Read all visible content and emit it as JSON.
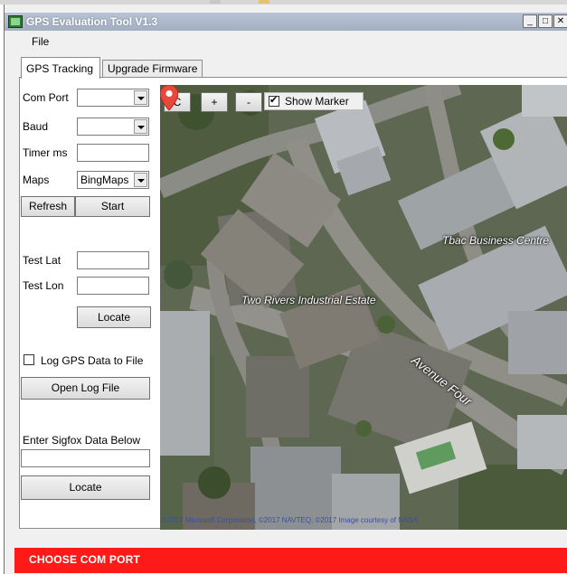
{
  "window": {
    "title": "GPS Evaluation Tool V1.3"
  },
  "menu": {
    "file_label": "File"
  },
  "tabs": [
    {
      "label": "GPS Tracking",
      "active": true
    },
    {
      "label": "Upgrade Firmware",
      "active": false
    }
  ],
  "form": {
    "com_port": {
      "label": "Com Port",
      "value": ""
    },
    "baud": {
      "label": "Baud",
      "value": ""
    },
    "timer": {
      "label": "Timer ms",
      "value": ""
    },
    "maps": {
      "label": "Maps",
      "value": "BingMaps"
    },
    "refresh_label": "Refresh",
    "start_label": "Start",
    "test_lat": {
      "label": "Test Lat",
      "value": ""
    },
    "test_lon": {
      "label": "Test Lon",
      "value": ""
    },
    "locate_label": "Locate",
    "log_gps": {
      "label": "Log GPS Data to File",
      "checked": false
    },
    "open_log_label": "Open Log File",
    "sigfox": {
      "label": "Enter Sigfox Data Below",
      "value": ""
    },
    "sigfox_locate_label": "Locate"
  },
  "map": {
    "controls": {
      "center": "C",
      "zoom_in": "+",
      "zoom_out": "-"
    },
    "show_marker": {
      "label": "Show Marker",
      "checked": true
    },
    "labels": {
      "business_centre": "Tbac Business Centre",
      "industrial_estate": "Two Rivers Industrial Estate",
      "road": "Avenue Four"
    },
    "copyright": "©2017 Microsoft Corporation, ©2017 NAVTEQ, ©2017 Image courtesy of NASA"
  },
  "status": {
    "text": "CHOOSE COM PORT",
    "color": "#ff1a1a"
  }
}
